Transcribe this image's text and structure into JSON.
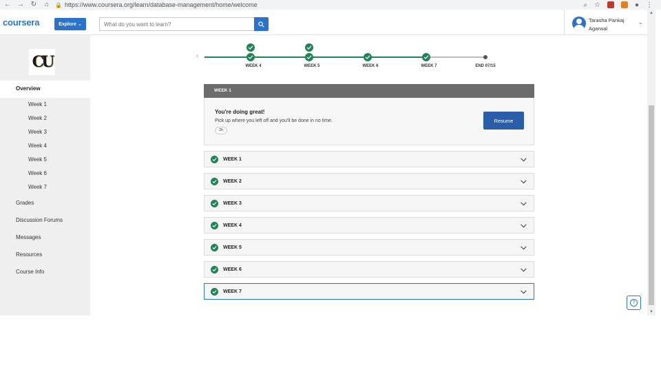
{
  "browser": {
    "url": "https://www.coursera.org/learn/database-management/home/welcome",
    "back_icon": "arrow-left-icon",
    "forward_icon": "arrow-right-icon",
    "reload_icon": "reload-icon",
    "home_icon": "home-icon"
  },
  "header": {
    "logo": "coursera",
    "explore_label": "Explore",
    "search_placeholder": "What do you want to learn?",
    "user_name_line1": "Tarasha Pankaj",
    "user_name_line2": "Agarwal",
    "brand_color": "#2a73cc"
  },
  "sidebar": {
    "overview_label": "Overview",
    "weeks": [
      "Week 1",
      "Week 2",
      "Week 3",
      "Week 4",
      "Week 5",
      "Week 6",
      "Week 7"
    ],
    "links": [
      "Grades",
      "Discussion Forums",
      "Messages",
      "Resources",
      "Course Info"
    ]
  },
  "timeline": {
    "labels": [
      "WEEK 4",
      "WEEK 5",
      "WEEK 6",
      "WEEK 7",
      "END 07/15"
    ],
    "progress_color": "#1f8354"
  },
  "current_week": {
    "header": "WEEK 1",
    "title": "You're doing great!",
    "subtitle": "Pick up where you left off and you'll be done in no time.",
    "time_badge": "2h",
    "resume_label": "Resume"
  },
  "accordion": {
    "items": [
      {
        "label": "WEEK 1",
        "completed": true
      },
      {
        "label": "WEEK 2",
        "completed": true
      },
      {
        "label": "WEEK 3",
        "completed": true
      },
      {
        "label": "WEEK 4",
        "completed": true
      },
      {
        "label": "WEEK 5",
        "completed": true
      },
      {
        "label": "WEEK 6",
        "completed": true
      },
      {
        "label": "WEEK 7",
        "completed": true
      }
    ]
  },
  "help": {
    "label": "?"
  }
}
